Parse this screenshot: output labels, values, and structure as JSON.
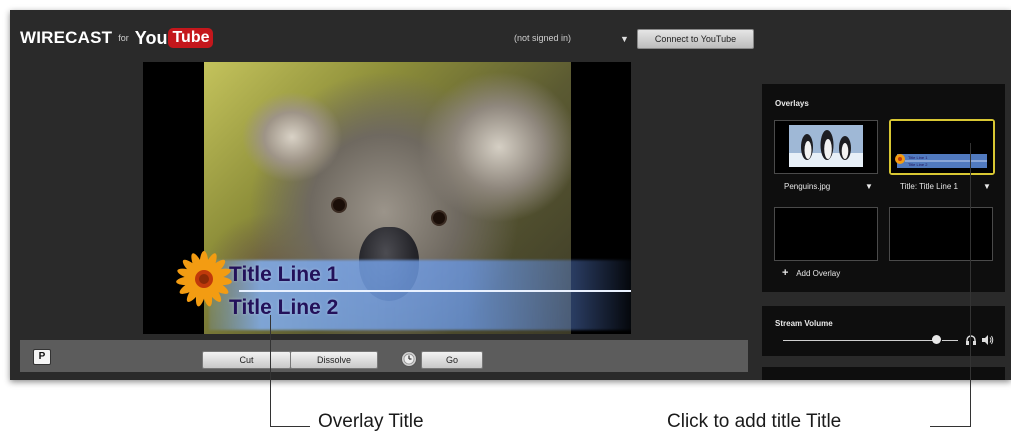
{
  "app": {
    "logo_wirecast": "WIRECAST",
    "logo_for": "for",
    "logo_you": "You",
    "logo_tube": "Tube"
  },
  "header": {
    "account_status": "(not signed in)",
    "account_dropdown_icon": "triangle-down-icon",
    "connect_button": "Connect to YouTube"
  },
  "preview": {
    "title_line_1": "Title Line 1",
    "title_line_2": "Title Line 2"
  },
  "transport": {
    "p_button": "P",
    "cut_button": "Cut",
    "dissolve_button": "Dissolve",
    "timer_icon": "clock-icon",
    "go_button": "Go"
  },
  "overlays": {
    "title": "Overlays",
    "items": [
      {
        "label": "Penguins.jpg",
        "selected": false
      },
      {
        "label": "Title: Title Line 1",
        "selected": true
      },
      {
        "label": "",
        "selected": false
      },
      {
        "label": "",
        "selected": false
      }
    ],
    "thumb_title_line_1": "Title Line 1",
    "thumb_title_line_2": "Title Line 2",
    "add_label": "Add Overlay"
  },
  "stream_volume": {
    "title": "Stream Volume",
    "level": 0.85,
    "headphones_icon": "headphones-icon",
    "speaker_icon": "speaker-icon"
  },
  "annotations": {
    "overlay_title": "Overlay Title",
    "click_to_add": "Click to add title Title"
  },
  "colors": {
    "selection": "#d8c733",
    "youtube_red": "#c4171c",
    "app_background": "#2a2a2a"
  }
}
